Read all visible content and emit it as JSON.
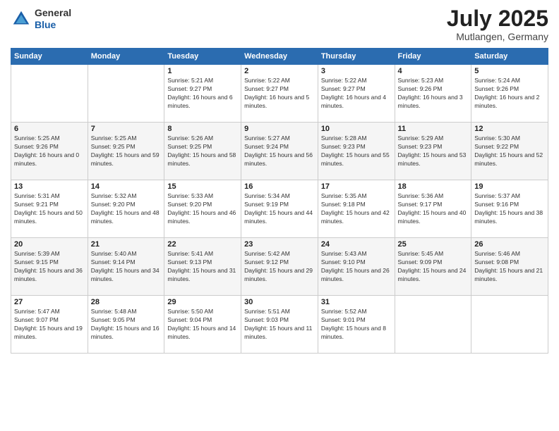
{
  "header": {
    "logo_line1": "General",
    "logo_line2": "Blue",
    "month_year": "July 2025",
    "location": "Mutlangen, Germany"
  },
  "weekdays": [
    "Sunday",
    "Monday",
    "Tuesday",
    "Wednesday",
    "Thursday",
    "Friday",
    "Saturday"
  ],
  "weeks": [
    [
      {
        "day": "",
        "sunrise": "",
        "sunset": "",
        "daylight": ""
      },
      {
        "day": "",
        "sunrise": "",
        "sunset": "",
        "daylight": ""
      },
      {
        "day": "1",
        "sunrise": "Sunrise: 5:21 AM",
        "sunset": "Sunset: 9:27 PM",
        "daylight": "Daylight: 16 hours and 6 minutes."
      },
      {
        "day": "2",
        "sunrise": "Sunrise: 5:22 AM",
        "sunset": "Sunset: 9:27 PM",
        "daylight": "Daylight: 16 hours and 5 minutes."
      },
      {
        "day": "3",
        "sunrise": "Sunrise: 5:22 AM",
        "sunset": "Sunset: 9:27 PM",
        "daylight": "Daylight: 16 hours and 4 minutes."
      },
      {
        "day": "4",
        "sunrise": "Sunrise: 5:23 AM",
        "sunset": "Sunset: 9:26 PM",
        "daylight": "Daylight: 16 hours and 3 minutes."
      },
      {
        "day": "5",
        "sunrise": "Sunrise: 5:24 AM",
        "sunset": "Sunset: 9:26 PM",
        "daylight": "Daylight: 16 hours and 2 minutes."
      }
    ],
    [
      {
        "day": "6",
        "sunrise": "Sunrise: 5:25 AM",
        "sunset": "Sunset: 9:26 PM",
        "daylight": "Daylight: 16 hours and 0 minutes."
      },
      {
        "day": "7",
        "sunrise": "Sunrise: 5:25 AM",
        "sunset": "Sunset: 9:25 PM",
        "daylight": "Daylight: 15 hours and 59 minutes."
      },
      {
        "day": "8",
        "sunrise": "Sunrise: 5:26 AM",
        "sunset": "Sunset: 9:25 PM",
        "daylight": "Daylight: 15 hours and 58 minutes."
      },
      {
        "day": "9",
        "sunrise": "Sunrise: 5:27 AM",
        "sunset": "Sunset: 9:24 PM",
        "daylight": "Daylight: 15 hours and 56 minutes."
      },
      {
        "day": "10",
        "sunrise": "Sunrise: 5:28 AM",
        "sunset": "Sunset: 9:23 PM",
        "daylight": "Daylight: 15 hours and 55 minutes."
      },
      {
        "day": "11",
        "sunrise": "Sunrise: 5:29 AM",
        "sunset": "Sunset: 9:23 PM",
        "daylight": "Daylight: 15 hours and 53 minutes."
      },
      {
        "day": "12",
        "sunrise": "Sunrise: 5:30 AM",
        "sunset": "Sunset: 9:22 PM",
        "daylight": "Daylight: 15 hours and 52 minutes."
      }
    ],
    [
      {
        "day": "13",
        "sunrise": "Sunrise: 5:31 AM",
        "sunset": "Sunset: 9:21 PM",
        "daylight": "Daylight: 15 hours and 50 minutes."
      },
      {
        "day": "14",
        "sunrise": "Sunrise: 5:32 AM",
        "sunset": "Sunset: 9:20 PM",
        "daylight": "Daylight: 15 hours and 48 minutes."
      },
      {
        "day": "15",
        "sunrise": "Sunrise: 5:33 AM",
        "sunset": "Sunset: 9:20 PM",
        "daylight": "Daylight: 15 hours and 46 minutes."
      },
      {
        "day": "16",
        "sunrise": "Sunrise: 5:34 AM",
        "sunset": "Sunset: 9:19 PM",
        "daylight": "Daylight: 15 hours and 44 minutes."
      },
      {
        "day": "17",
        "sunrise": "Sunrise: 5:35 AM",
        "sunset": "Sunset: 9:18 PM",
        "daylight": "Daylight: 15 hours and 42 minutes."
      },
      {
        "day": "18",
        "sunrise": "Sunrise: 5:36 AM",
        "sunset": "Sunset: 9:17 PM",
        "daylight": "Daylight: 15 hours and 40 minutes."
      },
      {
        "day": "19",
        "sunrise": "Sunrise: 5:37 AM",
        "sunset": "Sunset: 9:16 PM",
        "daylight": "Daylight: 15 hours and 38 minutes."
      }
    ],
    [
      {
        "day": "20",
        "sunrise": "Sunrise: 5:39 AM",
        "sunset": "Sunset: 9:15 PM",
        "daylight": "Daylight: 15 hours and 36 minutes."
      },
      {
        "day": "21",
        "sunrise": "Sunrise: 5:40 AM",
        "sunset": "Sunset: 9:14 PM",
        "daylight": "Daylight: 15 hours and 34 minutes."
      },
      {
        "day": "22",
        "sunrise": "Sunrise: 5:41 AM",
        "sunset": "Sunset: 9:13 PM",
        "daylight": "Daylight: 15 hours and 31 minutes."
      },
      {
        "day": "23",
        "sunrise": "Sunrise: 5:42 AM",
        "sunset": "Sunset: 9:12 PM",
        "daylight": "Daylight: 15 hours and 29 minutes."
      },
      {
        "day": "24",
        "sunrise": "Sunrise: 5:43 AM",
        "sunset": "Sunset: 9:10 PM",
        "daylight": "Daylight: 15 hours and 26 minutes."
      },
      {
        "day": "25",
        "sunrise": "Sunrise: 5:45 AM",
        "sunset": "Sunset: 9:09 PM",
        "daylight": "Daylight: 15 hours and 24 minutes."
      },
      {
        "day": "26",
        "sunrise": "Sunrise: 5:46 AM",
        "sunset": "Sunset: 9:08 PM",
        "daylight": "Daylight: 15 hours and 21 minutes."
      }
    ],
    [
      {
        "day": "27",
        "sunrise": "Sunrise: 5:47 AM",
        "sunset": "Sunset: 9:07 PM",
        "daylight": "Daylight: 15 hours and 19 minutes."
      },
      {
        "day": "28",
        "sunrise": "Sunrise: 5:48 AM",
        "sunset": "Sunset: 9:05 PM",
        "daylight": "Daylight: 15 hours and 16 minutes."
      },
      {
        "day": "29",
        "sunrise": "Sunrise: 5:50 AM",
        "sunset": "Sunset: 9:04 PM",
        "daylight": "Daylight: 15 hours and 14 minutes."
      },
      {
        "day": "30",
        "sunrise": "Sunrise: 5:51 AM",
        "sunset": "Sunset: 9:03 PM",
        "daylight": "Daylight: 15 hours and 11 minutes."
      },
      {
        "day": "31",
        "sunrise": "Sunrise: 5:52 AM",
        "sunset": "Sunset: 9:01 PM",
        "daylight": "Daylight: 15 hours and 8 minutes."
      },
      {
        "day": "",
        "sunrise": "",
        "sunset": "",
        "daylight": ""
      },
      {
        "day": "",
        "sunrise": "",
        "sunset": "",
        "daylight": ""
      }
    ]
  ]
}
